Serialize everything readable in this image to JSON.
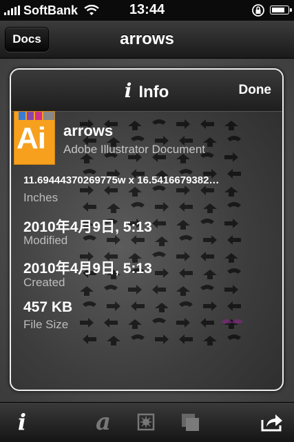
{
  "status_bar": {
    "carrier": "SoftBank",
    "time": "13:44"
  },
  "nav": {
    "back_label": "Docs",
    "title": "arrows"
  },
  "info_panel": {
    "title": "Info",
    "done_label": "Done",
    "file_name": "arrows",
    "file_type": "Adobe Illustrator Document",
    "icon_text": "Ai",
    "dimensions": "11.69444370269775w x 16.5416679382…",
    "dimensions_label": "Inches",
    "modified": "2010年4月9日, 5:13",
    "modified_label": "Modified",
    "created": "2010年4月9日, 5:13",
    "created_label": "Created",
    "file_size": "457 KB",
    "file_size_label": "File Size",
    "artwork_signature": "Pink Moustache"
  },
  "toolbar": {
    "items": [
      "info-icon",
      "font-icon",
      "image-icon",
      "layers-icon",
      "share-icon"
    ]
  },
  "colors": {
    "ai_orange": "#f7a01e",
    "ai_stripes": [
      "#3a7bd5",
      "#8e44ad",
      "#d0308a",
      "#888888"
    ]
  }
}
